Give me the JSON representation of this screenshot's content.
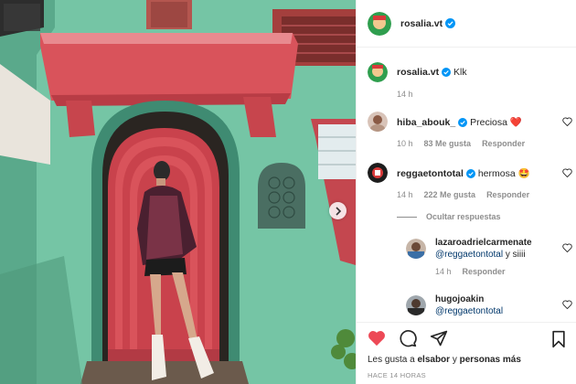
{
  "post": {
    "author": "rosalia.vt",
    "verified_icon": "verified-badge-icon"
  },
  "comments": [
    {
      "user": "rosalia.vt",
      "text": "Klk",
      "time": "14 h",
      "likes": "",
      "reply": ""
    },
    {
      "user": "hiba_abouk_",
      "text": "Preciosa",
      "emoji": "❤️",
      "time": "10 h",
      "likes": "83 Me gusta",
      "reply": "Responder"
    },
    {
      "user": "reggaetontotal",
      "text": "hermosa",
      "emoji": "🤩",
      "time": "14 h",
      "likes": "222 Me gusta",
      "reply": "Responder"
    }
  ],
  "replies_toggle": "Ocultar respuestas",
  "replies": [
    {
      "user": "lazaroadrielcarmenate",
      "mention": "@reggaetontotal",
      "text": " y siiii",
      "time": "14 h",
      "reply": "Responder"
    },
    {
      "user": "hugojoakin",
      "mention": "@reggaetontotal",
      "text": ""
    }
  ],
  "likes_line": {
    "prefix": "Les gusta a ",
    "user": "elsabor",
    "middle": " y ",
    "others": "personas más"
  },
  "timestamp": "HACE 14 HORAS",
  "colors": {
    "like_red": "#ed4956",
    "verified_blue": "#0095f6",
    "wall": "#6fbf9f",
    "door": "#d9535b"
  }
}
